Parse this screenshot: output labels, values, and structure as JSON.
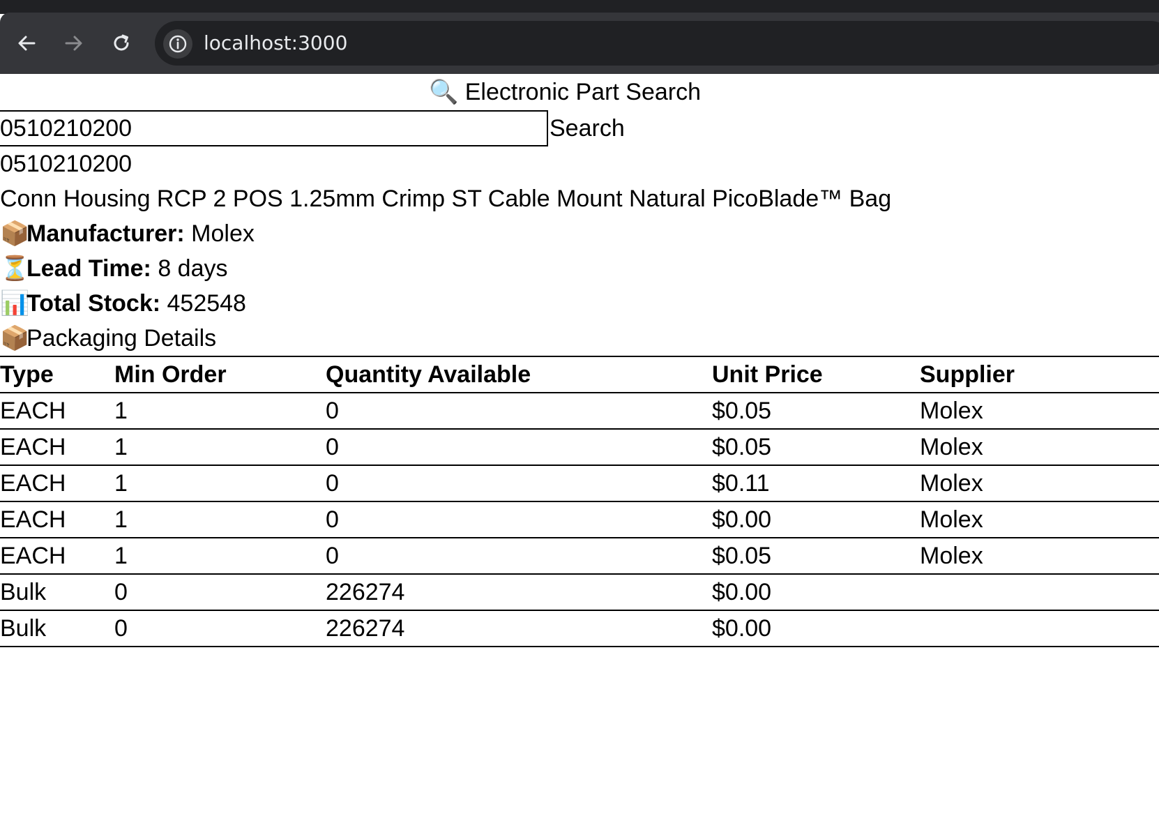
{
  "browser": {
    "url": "localhost:3000",
    "icons": [
      "back-arrow-icon",
      "forward-arrow-icon",
      "reload-icon",
      "site-info-icon"
    ]
  },
  "page": {
    "title": "🔍 Electronic Part Search",
    "search": {
      "value": "0510210200",
      "button_label": "Search"
    },
    "part": {
      "number": "0510210200",
      "description": "Conn Housing RCP 2 POS 1.25mm Crimp ST Cable Mount Natural PicoBlade™ Bag",
      "manufacturer_icon": "📦",
      "manufacturer_label": "Manufacturer:",
      "manufacturer": "Molex",
      "lead_time_icon": "⏳",
      "lead_time_label": "Lead Time:",
      "lead_time": "8 days",
      "stock_icon": "📊",
      "stock_label": "Total Stock:",
      "stock": "452548"
    },
    "packaging": {
      "icon": "📦",
      "heading": "Packaging Details",
      "columns": [
        "Type",
        "Min Order",
        "Quantity Available",
        "Unit Price",
        "Supplier"
      ],
      "rows": [
        [
          "EACH",
          "1",
          "0",
          "$0.05",
          "Molex"
        ],
        [
          "EACH",
          "1",
          "0",
          "$0.05",
          "Molex"
        ],
        [
          "EACH",
          "1",
          "0",
          "$0.11",
          "Molex"
        ],
        [
          "EACH",
          "1",
          "0",
          "$0.00",
          "Molex"
        ],
        [
          "EACH",
          "1",
          "0",
          "$0.05",
          "Molex"
        ],
        [
          "Bulk",
          "0",
          "226274",
          "$0.00",
          ""
        ],
        [
          "Bulk",
          "0",
          "226274",
          "$0.00",
          ""
        ]
      ]
    }
  }
}
